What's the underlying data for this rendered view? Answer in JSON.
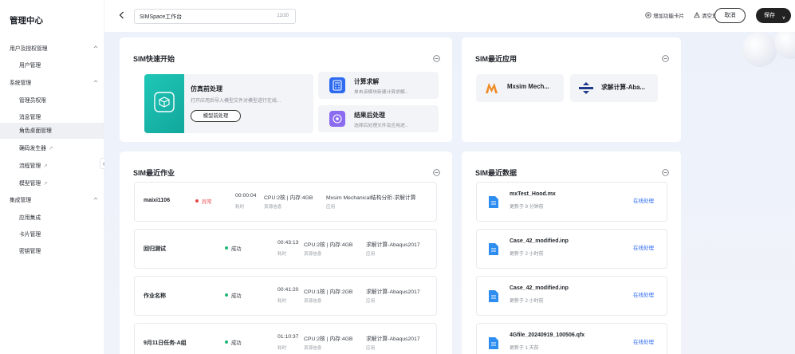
{
  "sidebar": {
    "title": "管理中心",
    "items": [
      {
        "label": "用户及授权管理",
        "type": "group"
      },
      {
        "label": "用户管理",
        "type": "sub"
      },
      {
        "label": "系统管理",
        "type": "group"
      },
      {
        "label": "管理员权限",
        "type": "sub"
      },
      {
        "label": "消息管理",
        "type": "sub"
      },
      {
        "label": "角色桌面管理",
        "type": "sub",
        "active": true
      },
      {
        "label": "确码发生器",
        "type": "sub",
        "external": true
      },
      {
        "label": "流程管理",
        "type": "sub",
        "external": true
      },
      {
        "label": "模型管理",
        "type": "sub",
        "external": true
      },
      {
        "label": "集成管理",
        "type": "group"
      },
      {
        "label": "应用集成",
        "type": "sub"
      },
      {
        "label": "卡片管理",
        "type": "sub"
      },
      {
        "label": "密钥管理",
        "type": "sub"
      }
    ]
  },
  "topbar": {
    "title_value": "SIMSpace工作台",
    "title_count": "11/20",
    "add_card": "增加功能卡片",
    "clear_desktop": "清空角色桌面",
    "cancel": "取消",
    "save": "保存"
  },
  "quick_start": {
    "title": "SIM快速开始",
    "big": {
      "title": "仿真前处理",
      "desc": "打开应用后导入模型文件对模型进行在线...",
      "button": "模型前处理"
    },
    "solve": {
      "title": "计算求解",
      "desc": "单击该模块新建计算求解..."
    },
    "post": {
      "title": "结果后处理",
      "desc": "选择后处理文件及应用进..."
    }
  },
  "recent_apps": {
    "title": "SIM最近应用",
    "items": [
      "Mxsim Mech...",
      "求解计算-Aba..."
    ]
  },
  "recent_jobs": {
    "title": "SIM最近作业",
    "items": [
      {
        "name": "maixi1106",
        "status": "异常",
        "status_color": "#e5484d",
        "time": "00:00:04",
        "time_label": "耗时",
        "resource": "CPU:2核 | 内存:4GB",
        "resource_label": "资源信息",
        "app": "Mxsim Mechanical结构分析-求解计算",
        "app_label": "应用"
      },
      {
        "name": "回归测试",
        "status": "成功",
        "status_color": "#21b573",
        "time": "00:43:13",
        "time_label": "耗时",
        "resource": "CPU:2核 | 内存:4GB",
        "resource_label": "资源信息",
        "app": "求解计算-Abaqus2017",
        "app_label": "应用"
      },
      {
        "name": "作业名称",
        "status": "成功",
        "status_color": "#21b573",
        "time": "00:41:20",
        "time_label": "耗时",
        "resource": "CPU:1核 | 内存:2GB",
        "resource_label": "资源信息",
        "app": "求解计算-Abaqus2017",
        "app_label": "应用"
      },
      {
        "name": "9月11日任务-A组",
        "status": "成功",
        "status_color": "#21b573",
        "time": "01:10:37",
        "time_label": "耗时",
        "resource": "CPU:2核 | 内存:4GB",
        "resource_label": "资源信息",
        "app": "求解计算-Abaqus2017",
        "app_label": "应用"
      }
    ]
  },
  "recent_data": {
    "title": "SIM最近数据",
    "items": [
      {
        "name": "mxTest_Hood.mx",
        "updated": "更新于 9 分钟前",
        "action": "在线处理"
      },
      {
        "name": "Case_42_modified.inp",
        "updated": "更新于 2 小时前",
        "action": "在线处理"
      },
      {
        "name": "Case_42_modified.inp",
        "updated": "更新于 2 小时前",
        "action": "在线处理"
      },
      {
        "name": "4Gfile_20240919_100506.qfx",
        "updated": "更新于 1 天前",
        "action": "在线处理"
      }
    ]
  },
  "colors": {
    "accent": "#2e6bf0",
    "teal": "#17b5a8",
    "purple": "#8b6cf0"
  }
}
